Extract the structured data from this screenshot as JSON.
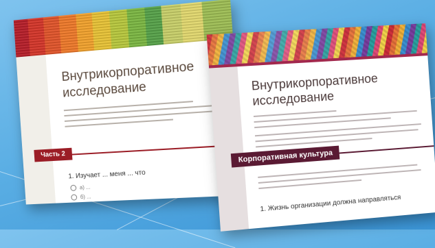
{
  "colors": {
    "background": "#5aaee4",
    "left_accent": "#9b1d26",
    "right_accent": "#5a1a33"
  },
  "left_form": {
    "title": "Внутрикорпоративное исследование",
    "section_label": "Часть 2",
    "question": "1. Изучает ... меня ... что",
    "options": [
      "а) ...",
      "б) ..."
    ]
  },
  "right_form": {
    "title": "Внутрикорпоративное исследование",
    "section_label": "Корпоративная культура",
    "question": "1. Жизнь организации должна направляться"
  }
}
